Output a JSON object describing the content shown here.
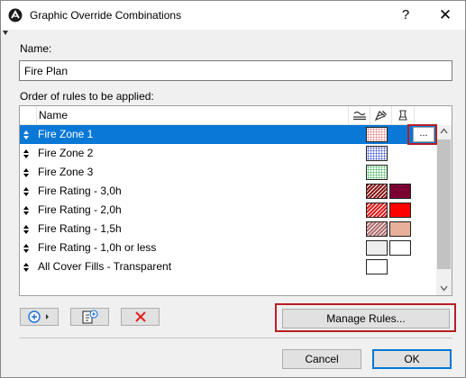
{
  "window": {
    "title": "Graphic Override Combinations",
    "help_glyph": "?",
    "close_glyph": "✕"
  },
  "name_section": {
    "label": "Name:",
    "value": "Fire Plan"
  },
  "rules_section": {
    "label": "Order of rules to be applied:",
    "column_name": "Name",
    "column_icons": [
      "line-icon",
      "fill-pen-icon",
      "fill-background-icon"
    ]
  },
  "rules": [
    {
      "name": "Fire Zone 1",
      "selected": true,
      "fill_pattern": "dots",
      "fill_color": "#e87b7b",
      "background_color": null
    },
    {
      "name": "Fire Zone 2",
      "selected": false,
      "fill_pattern": "dots",
      "fill_color": "#3a4fd1",
      "background_color": null
    },
    {
      "name": "Fire Zone 3",
      "selected": false,
      "fill_pattern": "dots",
      "fill_color": "#3fb85a",
      "background_color": null
    },
    {
      "name": "Fire Rating - 3,0h",
      "selected": false,
      "fill_pattern": "hatch",
      "fill_color": "#8b1a1a",
      "background_color": "#7a0034"
    },
    {
      "name": "Fire Rating - 2,0h",
      "selected": false,
      "fill_pattern": "hatch",
      "fill_color": "#e02020",
      "background_color": "#ff0000"
    },
    {
      "name": "Fire Rating - 1,5h",
      "selected": false,
      "fill_pattern": "hatch",
      "fill_color": "#b07070",
      "background_color": "#e8b09a"
    },
    {
      "name": "Fire Rating - 1,0h or less",
      "selected": false,
      "fill_pattern": "solid",
      "fill_color": "#eeeeee",
      "background_color": "#ffffff"
    },
    {
      "name": "All Cover Fills - Transparent",
      "selected": false,
      "fill_pattern": "empty",
      "fill_color": "#ffffff",
      "background_color": null
    }
  ],
  "more_button_label": "...",
  "toolbar": {
    "add_icon": "add-circle-icon",
    "import_icon": "import-rule-icon",
    "delete_icon": "delete-x-icon"
  },
  "buttons": {
    "manage_rules": "Manage Rules...",
    "cancel": "Cancel",
    "ok": "OK"
  },
  "colors": {
    "selection": "#0a78d7",
    "highlight_annotation": "#b41f24",
    "delete_icon": "#e0201e",
    "add_icon": "#1a6fd6"
  }
}
